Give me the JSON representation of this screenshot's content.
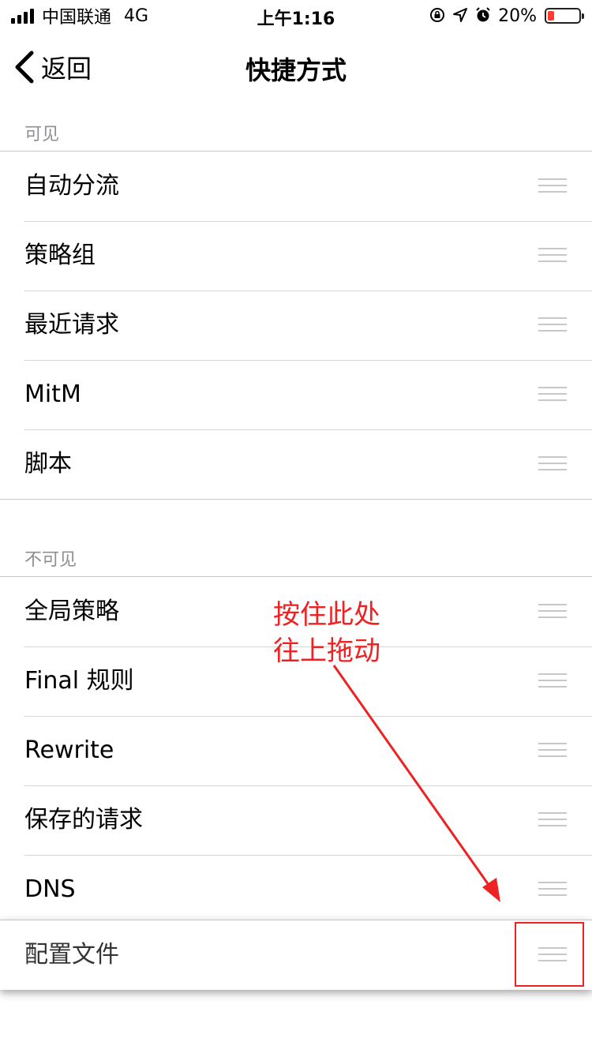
{
  "status_bar": {
    "carrier": "中国联通",
    "network": "4G",
    "time": "上午1:16",
    "battery": "20%",
    "battery_level": 0.2,
    "icons": [
      "orientation-lock-icon",
      "location-arrow-icon",
      "alarm-icon"
    ]
  },
  "nav": {
    "back_label": "返回",
    "title": "快捷方式"
  },
  "visible_section": {
    "header": "可见",
    "items": [
      "自动分流",
      "策略组",
      "最近请求",
      "MitM",
      "脚本"
    ]
  },
  "hidden_section": {
    "header": "不可见",
    "items": [
      "全局策略",
      "Final 规则",
      "Rewrite",
      "保存的请求",
      "DNS"
    ]
  },
  "dragging_item": {
    "label": "配置文件"
  },
  "annotation": {
    "line1": "按住此处",
    "line2": "往上拖动",
    "color": "#ee2222"
  },
  "colors": {
    "separator": "#c8c7cc",
    "section_header": "#8e8e93",
    "grip": "#c7c7cc",
    "battery_low": "#ff3b30"
  }
}
